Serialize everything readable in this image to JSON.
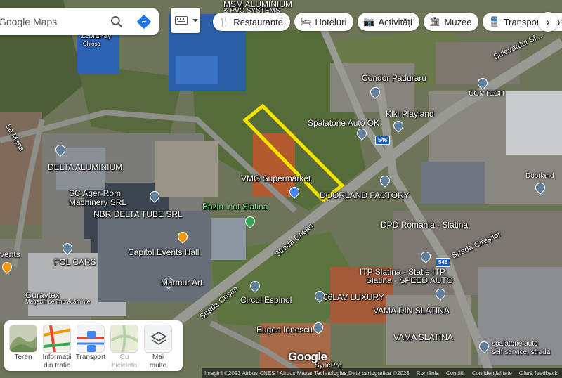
{
  "search": {
    "placeholder": "Google Maps"
  },
  "chips": [
    {
      "icon": "restaurant-icon",
      "glyph": "🍴",
      "label": "Restaurante"
    },
    {
      "icon": "hotel-icon",
      "glyph": "🛏",
      "label": "Hoteluri"
    },
    {
      "icon": "camera-icon",
      "glyph": "📷",
      "label": "Activități"
    },
    {
      "icon": "museum-icon",
      "glyph": "🏛",
      "label": "Muzee"
    },
    {
      "icon": "transit-icon",
      "glyph": "🚆",
      "label": "Transport public"
    }
  ],
  "chip_next": "›",
  "map_labels": {
    "msm": "MSM ALUMINIUM",
    "pvc": "& PVC SYSTEMS",
    "zebrapay": "ZebraPay",
    "chiosc": "Chioșc",
    "condor": "Condor Paduraru",
    "comtech": "COMTECH",
    "kiki": "Kiki Playland",
    "spalatorie": "Spalatorie Auto OK",
    "delta": "DELTA ALUMINIUM",
    "scager": "SC Ager-Rom",
    "machinery": "Machinery SRL",
    "nbr": "NBR DELTA TUBE SRL",
    "vmg": "VMG Supermarket",
    "doorland_factory": "DOORLAND FACTORY",
    "doorland": "Doorland",
    "bazin": "Bazin Inot Slatina",
    "dpd": "DPD Romania - Slatina",
    "capitol": "Capitol Events Hall",
    "events": "vents",
    "fol": "FOL CARS",
    "marmur": "Marmur Art",
    "itp": "ITP Slatina - Statie ITP",
    "itp2": "Slatina - SPEED AUTO",
    "guraytex": "Guraytex",
    "guraytex_sub": "Magazin de îmbrăcăminte",
    "circul": "Circul Espinol",
    "lux": "06LAV LUXURY",
    "vama1": "VAMA DIN SLATINA",
    "vama2": "VAMA SLATINA",
    "eugen": "Eugen Ionescu",
    "spal2": "spalatorie auto",
    "spal3": "self service, strada",
    "strada_crisan_1": "Strada Crișan",
    "strada_crisan_2": "Strada Crișan",
    "strada_crisan_3": "Strada Cireșilor",
    "bulevard": "Bulevardul Sf...",
    "cuza": "Strada",
    "route_546a": "546",
    "route_546b": "546",
    "synepro": "SynePro",
    "seamind": "Le Mans"
  },
  "layers": [
    {
      "icon": "terrain-icon",
      "label1": "Teren",
      "label2": ""
    },
    {
      "icon": "traffic-icon",
      "label1": "Informații",
      "label2": "din trafic"
    },
    {
      "icon": "transit-layer-icon",
      "label1": "Transport",
      "label2": ""
    },
    {
      "icon": "bicycle-icon",
      "label1": "Cu",
      "label2": "bicicleta"
    },
    {
      "icon": "more-layers-icon",
      "label1": "Mai",
      "label2": "multe"
    }
  ],
  "google_logo": "Google",
  "footer": {
    "imagery": "Imagini ©2023 Airbus,CNES / Airbus,Maxar Technologies,Date cartografice ©2023",
    "country": "România",
    "terms": "Condiții",
    "privacy": "Confidențialitate",
    "feedback": "Oferă feedback"
  },
  "colors": {
    "highlight": "#f2e300",
    "chip_bg": "#ffffff"
  }
}
